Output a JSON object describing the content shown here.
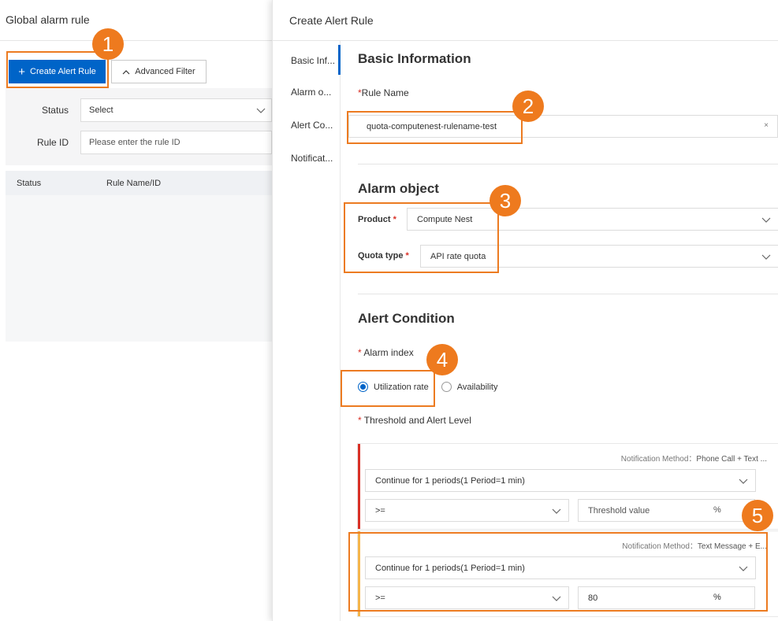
{
  "left": {
    "title": "Global alarm rule",
    "create_button": "Create Alert Rule",
    "advanced_filter": "Advanced Filter",
    "filters": {
      "status_label": "Status",
      "status_value": "Select",
      "rule_id_label": "Rule ID",
      "rule_id_placeholder": "Please enter the rule ID"
    },
    "table_columns": [
      "Status",
      "Rule Name/ID"
    ]
  },
  "drawer": {
    "title": "Create Alert Rule",
    "nav": [
      "Basic Inf...",
      "Alarm o...",
      "Alert Co...",
      "Notificat..."
    ],
    "basic": {
      "title": "Basic Information",
      "rule_name_label": "Rule Name",
      "rule_name_value": "quota-computenest-rulename-test",
      "clear": "×"
    },
    "alarm_object": {
      "title": "Alarm object",
      "product_label": "Product",
      "product_value": "Compute Nest",
      "quota_type_label": "Quota type",
      "quota_type_value": "API rate quota"
    },
    "alert_condition": {
      "title": "Alert Condition",
      "alarm_index_label": "Alarm index",
      "options": [
        "Utilization rate",
        "Availability"
      ],
      "selected_option": "Utilization rate",
      "threshold_label": "Threshold and Alert Level",
      "levels": [
        {
          "notify_label": "Notification Method：",
          "notify_value": "Phone Call + Text ...",
          "period": "Continue for 1 periods(1 Period=1 min)",
          "operator": ">=",
          "threshold": "Threshold value",
          "unit": "%",
          "color": "#d93026"
        },
        {
          "notify_label": "Notification Method：",
          "notify_value": "Text Message + E...",
          "period": "Continue for 1 periods(1 Period=1 min)",
          "operator": ">=",
          "threshold": "80",
          "unit": "%",
          "color": "#f5b54a"
        }
      ]
    }
  },
  "annotations": [
    "1",
    "2",
    "3",
    "4",
    "5"
  ],
  "colors": {
    "primary": "#0064c8",
    "annotation": "#ec7b21",
    "required": "#d93026"
  }
}
